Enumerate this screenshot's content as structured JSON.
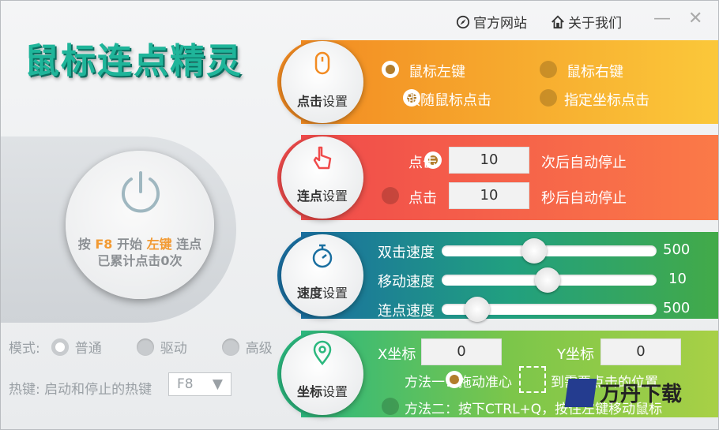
{
  "app": {
    "title": "鼠标连点精灵"
  },
  "top": {
    "official_site": "官方网站",
    "about": "关于我们",
    "minimize": "—",
    "close": "✕"
  },
  "center": {
    "line1_pre": "按 ",
    "hotkey": "F8",
    "line1_mid": " 开始 ",
    "button": "左键",
    "line1_post": " 连点",
    "line2": "已累计点击0次"
  },
  "mode": {
    "label": "模式:",
    "options": [
      "普通",
      "驱动",
      "高级"
    ],
    "selected": "普通"
  },
  "hotkey": {
    "label": "热键: 启动和停止的热键",
    "value": "F8",
    "arrow": "▼"
  },
  "click_settings": {
    "badge_bold": "点击",
    "badge_rest": "设置",
    "options": [
      "鼠标左键",
      "鼠标右键",
      "跟随鼠标点击",
      "指定坐标点击"
    ],
    "selected": [
      "鼠标左键",
      "跟随鼠标点击"
    ]
  },
  "repeat_settings": {
    "badge_bold": "连点",
    "badge_rest": "设置",
    "row1": {
      "prefix": "点击",
      "value": "10",
      "suffix": "次后自动停止"
    },
    "row2": {
      "prefix": "点击",
      "value": "10",
      "suffix": "秒后自动停止"
    }
  },
  "speed_settings": {
    "badge_bold": "速度",
    "badge_rest": "设置",
    "rows": [
      {
        "label": "双击速度",
        "value": "500",
        "level": 0.42
      },
      {
        "label": "移动速度",
        "value": "10",
        "level": 0.49
      },
      {
        "label": "连点速度",
        "value": "500",
        "level": 0.12
      }
    ]
  },
  "coord_settings": {
    "badge_bold": "坐标",
    "badge_rest": "设置",
    "x_label": "X坐标",
    "x_value": "0",
    "y_label": "Y坐标",
    "y_value": "0",
    "method1_pre": "方法一：拖动准心",
    "method1_post": "到需要点击的位置",
    "method2": "方法二：按下CTRL+Q，按住左键移动鼠标"
  },
  "watermark": {
    "text": "万丹下载"
  },
  "colors": {
    "orange": "#f29a33",
    "title": "#1fb59a"
  }
}
